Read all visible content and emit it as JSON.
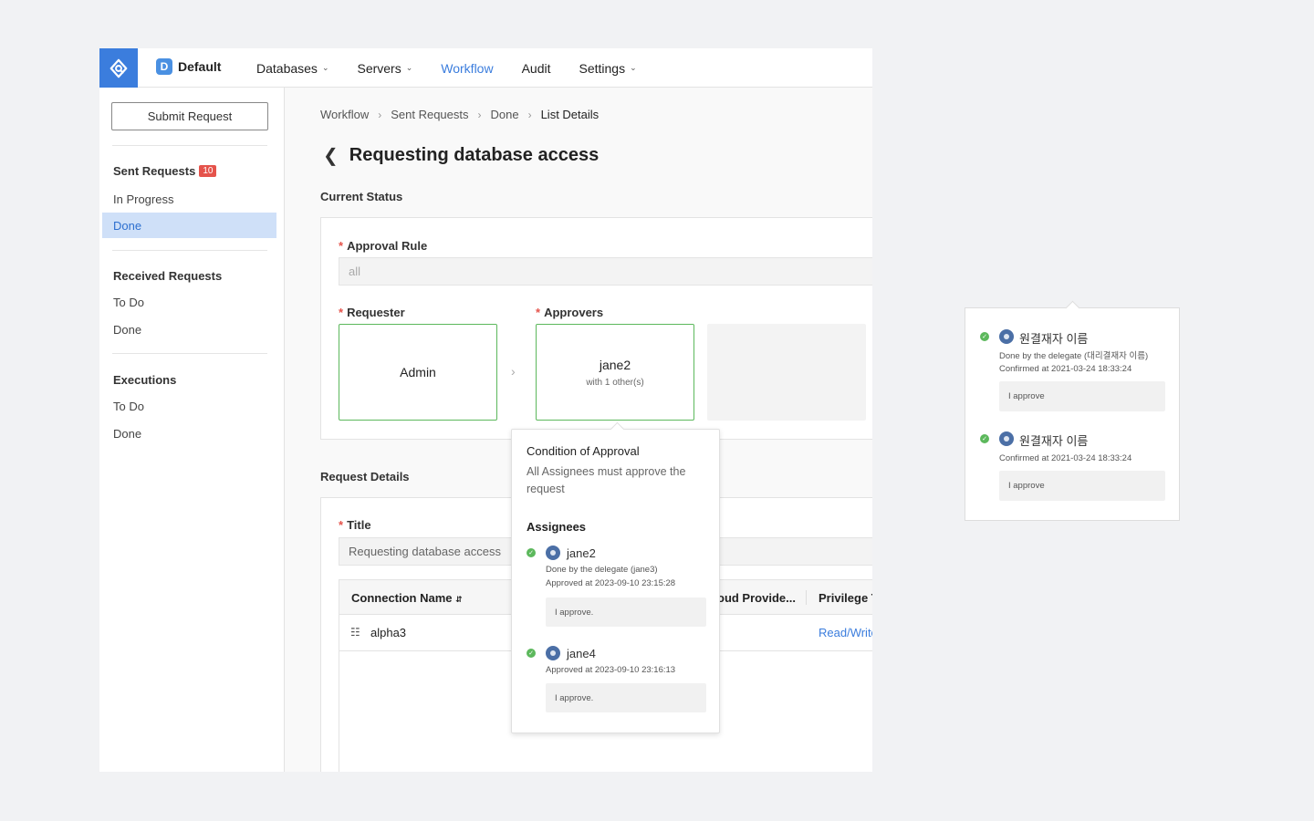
{
  "header": {
    "workspace_badge": "D",
    "workspace_name": "Default",
    "nav": [
      {
        "label": "Databases",
        "dropdown": true
      },
      {
        "label": "Servers",
        "dropdown": true
      },
      {
        "label": "Workflow",
        "dropdown": false,
        "active": true
      },
      {
        "label": "Audit",
        "dropdown": false
      },
      {
        "label": "Settings",
        "dropdown": true
      }
    ],
    "accent_color": "#3b7ddd"
  },
  "sidebar": {
    "submit_label": "Submit Request",
    "sent": {
      "label": "Sent Requests",
      "badge": "10",
      "items": [
        "In Progress",
        "Done"
      ]
    },
    "received": {
      "label": "Received Requests",
      "items": [
        "To Do",
        "Done"
      ]
    },
    "executions": {
      "label": "Executions",
      "items": [
        "To Do",
        "Done"
      ]
    }
  },
  "breadcrumb": [
    "Workflow",
    "Sent Requests",
    "Done",
    "List Details"
  ],
  "page_title": "Requesting database access",
  "current_status": {
    "section_label": "Current Status",
    "approval_rule_label": "Approval Rule",
    "approval_rule_value": "all",
    "requester_label": "Requester",
    "requester_name": "Admin",
    "approvers_label": "Approvers",
    "approver_name": "jane2",
    "approver_sub": "with 1 other(s)"
  },
  "request_details": {
    "section_label": "Request Details",
    "title_label": "Title",
    "title_value": "Requesting database access",
    "columns": [
      "Connection Name",
      "oud Provide...",
      "Privilege T"
    ],
    "rows": [
      {
        "connection": "alpha3",
        "privilege": "Read/Write"
      }
    ]
  },
  "popover": {
    "title": "Condition of Approval",
    "condition": "All Assignees must approve the request",
    "assignees_label": "Assignees",
    "assignees": [
      {
        "name": "jane2",
        "meta1": "Done by the delegate (jane3)",
        "meta2": "Approved at 2023-09-10 23:15:28",
        "comment": "I approve."
      },
      {
        "name": "jane4",
        "meta1": "Approved at 2023-09-10 23:16:13",
        "comment": "I approve."
      }
    ]
  },
  "right_panel": {
    "entries": [
      {
        "name": "원결재자 이름",
        "meta1": "Done by the delegate (대리결재자 이름)",
        "meta2": "Confirmed at 2021-03-24 18:33:24",
        "comment": "I approve"
      },
      {
        "name": "원결재자 이름",
        "meta1": "Confirmed at 2021-03-24 18:33:24",
        "comment": "I approve"
      }
    ]
  }
}
